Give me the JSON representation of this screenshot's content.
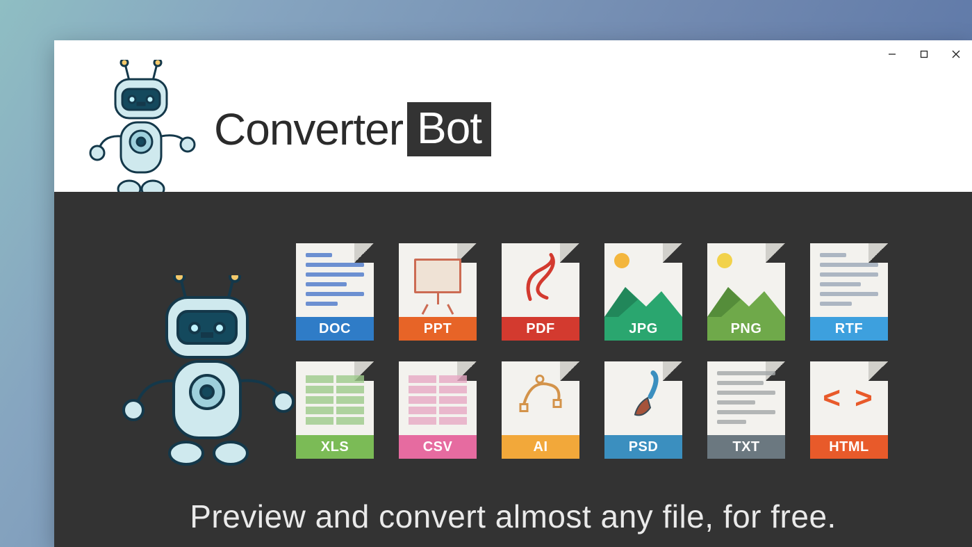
{
  "app": {
    "title_part1": "Converter",
    "title_part2": "Bot"
  },
  "tagline": "Preview and convert almost any file, for free.",
  "file_types": [
    {
      "label": "DOC",
      "color": "#2f7cc7",
      "icon": "doc"
    },
    {
      "label": "PPT",
      "color": "#e76427",
      "icon": "ppt"
    },
    {
      "label": "PDF",
      "color": "#d33a2f",
      "icon": "pdf"
    },
    {
      "label": "JPG",
      "color": "#2aa66f",
      "icon": "jpg"
    },
    {
      "label": "PNG",
      "color": "#6fa94a",
      "icon": "png"
    },
    {
      "label": "RTF",
      "color": "#3da0de",
      "icon": "rtf"
    },
    {
      "label": "XLS",
      "color": "#7bbb56",
      "icon": "xls"
    },
    {
      "label": "CSV",
      "color": "#e66ba0",
      "icon": "csv"
    },
    {
      "label": "AI",
      "color": "#f2a83a",
      "icon": "ai"
    },
    {
      "label": "PSD",
      "color": "#3b8fbf",
      "icon": "psd"
    },
    {
      "label": "TXT",
      "color": "#6b7880",
      "icon": "txt"
    },
    {
      "label": "HTML",
      "color": "#e85a2a",
      "icon": "html"
    }
  ]
}
